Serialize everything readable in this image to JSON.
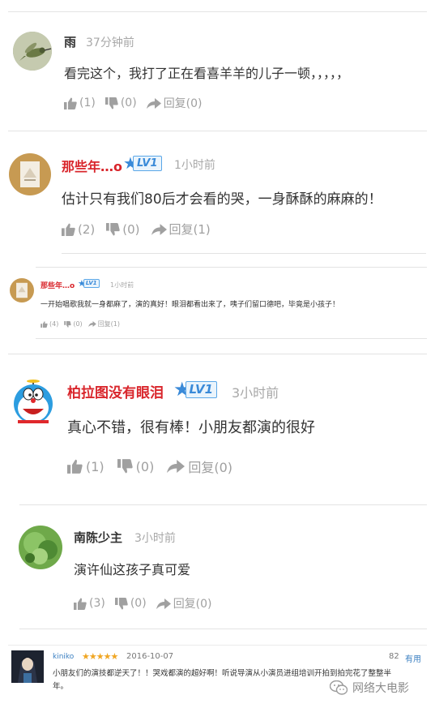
{
  "c1": {
    "name": "雨",
    "time": "37分钟前",
    "text": "看完这个，我打了正在看喜羊羊的儿子一顿，，，，，",
    "like": "(1)",
    "dislike": "(0)",
    "reply": "回复(0)"
  },
  "c2": {
    "name": "那些年…o",
    "level": "LV1",
    "time": "1小时前",
    "text": "估计只有我们80后才会看的哭，一身酥酥的麻麻的！",
    "like": "(2)",
    "dislike": "(0)",
    "reply": "回复(1)"
  },
  "c3": {
    "name": "那些年…o",
    "level": "LV1",
    "time": "1小时前",
    "text": "一开始唱歌我就一身都麻了，演的真好！眼泪都看出来了，咦子们留口德吧，毕竟是小孩子！",
    "like": "(4)",
    "dislike": "(0)",
    "reply": "回复(1)"
  },
  "c4": {
    "name": "柏拉图没有眼泪",
    "level": "LV1",
    "time": "3小时前",
    "text": "真心不错，很有棒！小朋友都演的很好",
    "like": "(1)",
    "dislike": "(0)",
    "reply": "回复(0)"
  },
  "c5": {
    "name": "南陈少主",
    "time": "3小时前",
    "text": "演许仙这孩子真可爱",
    "like": "(3)",
    "dislike": "(0)",
    "reply": "回复(0)"
  },
  "c6": {
    "name": "kiniko",
    "stars": "★★★★★",
    "date": "2016-10-07",
    "count": "82",
    "useful": "有用",
    "text_line1": "小朋友们的演技都逆天了！！哭戏都演的超好啊！听说导演从小演员进组培训开拍到拍完花了整整半",
    "text_line2": "年。"
  },
  "watermark": {
    "text": "网络大电影"
  },
  "colors": {
    "red_name": "#d9262c",
    "gray_name": "#333333",
    "time": "#a8a8a8",
    "action": "#a0a0a0",
    "level_blue": "#3a8ad8",
    "star_gold": "#f0a623",
    "useful_blue": "#3a7fc1"
  }
}
